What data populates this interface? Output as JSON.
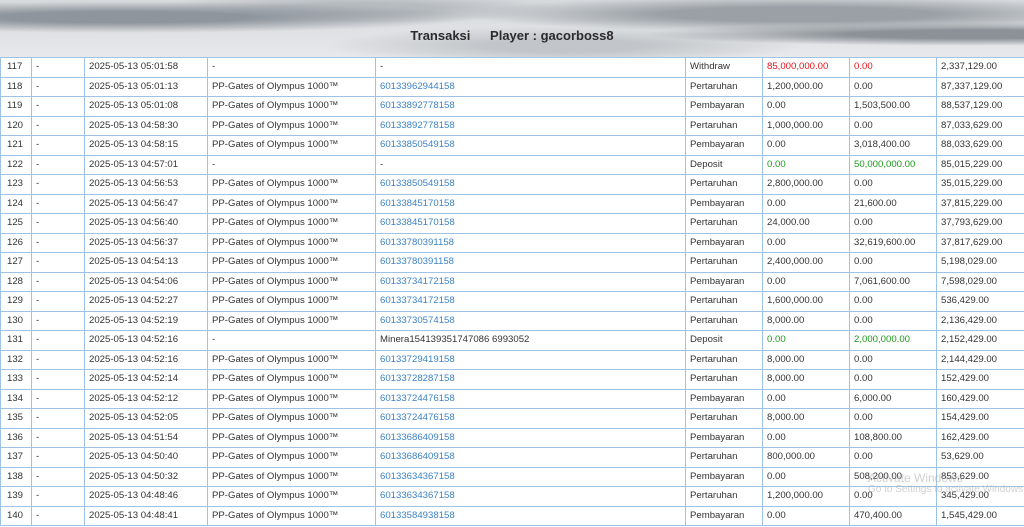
{
  "header": {
    "title": "Transaksi",
    "player": "Player : gacorboss8"
  },
  "rows": [
    {
      "no": "117",
      "col2": "-",
      "date": "2025-05-13 05:01:58",
      "game": "-",
      "ref": "-",
      "type": "Withdraw",
      "debit": "85,000,000.00",
      "credit": "0.00",
      "balance": "2,337,129.00",
      "debit_color": "red",
      "credit_color": "red"
    },
    {
      "no": "118",
      "col2": "-",
      "date": "2025-05-13 05:01:13",
      "game": "PP-Gates of Olympus 1000™",
      "ref": "60133962944158",
      "type": "Pertaruhan",
      "debit": "1,200,000.00",
      "credit": "0.00",
      "balance": "87,337,129.00"
    },
    {
      "no": "119",
      "col2": "-",
      "date": "2025-05-13 05:01:08",
      "game": "PP-Gates of Olympus 1000™",
      "ref": "60133892778158",
      "type": "Pembayaran",
      "debit": "0.00",
      "credit": "1,503,500.00",
      "balance": "88,537,129.00"
    },
    {
      "no": "120",
      "col2": "-",
      "date": "2025-05-13 04:58:30",
      "game": "PP-Gates of Olympus 1000™",
      "ref": "60133892778158",
      "type": "Pertaruhan",
      "debit": "1,000,000.00",
      "credit": "0.00",
      "balance": "87,033,629.00"
    },
    {
      "no": "121",
      "col2": "-",
      "date": "2025-05-13 04:58:15",
      "game": "PP-Gates of Olympus 1000™",
      "ref": "60133850549158",
      "type": "Pembayaran",
      "debit": "0.00",
      "credit": "3,018,400.00",
      "balance": "88,033,629.00"
    },
    {
      "no": "122",
      "col2": "-",
      "date": "2025-05-13 04:57:01",
      "game": "-",
      "ref": "-",
      "type": "Deposit",
      "debit": "0.00",
      "credit": "50,000,000.00",
      "balance": "85,015,229.00",
      "debit_color": "green",
      "credit_color": "green"
    },
    {
      "no": "123",
      "col2": "-",
      "date": "2025-05-13 04:56:53",
      "game": "PP-Gates of Olympus 1000™",
      "ref": "60133850549158",
      "type": "Pertaruhan",
      "debit": "2,800,000.00",
      "credit": "0.00",
      "balance": "35,015,229.00"
    },
    {
      "no": "124",
      "col2": "-",
      "date": "2025-05-13 04:56:47",
      "game": "PP-Gates of Olympus 1000™",
      "ref": "60133845170158",
      "type": "Pembayaran",
      "debit": "0.00",
      "credit": "21,600.00",
      "balance": "37,815,229.00"
    },
    {
      "no": "125",
      "col2": "-",
      "date": "2025-05-13 04:56:40",
      "game": "PP-Gates of Olympus 1000™",
      "ref": "60133845170158",
      "type": "Pertaruhan",
      "debit": "24,000.00",
      "credit": "0.00",
      "balance": "37,793,629.00"
    },
    {
      "no": "126",
      "col2": "-",
      "date": "2025-05-13 04:56:37",
      "game": "PP-Gates of Olympus 1000™",
      "ref": "60133780391158",
      "type": "Pembayaran",
      "debit": "0.00",
      "credit": "32,619,600.00",
      "balance": "37,817,629.00"
    },
    {
      "no": "127",
      "col2": "-",
      "date": "2025-05-13 04:54:13",
      "game": "PP-Gates of Olympus 1000™",
      "ref": "60133780391158",
      "type": "Pertaruhan",
      "debit": "2,400,000.00",
      "credit": "0.00",
      "balance": "5,198,029.00"
    },
    {
      "no": "128",
      "col2": "-",
      "date": "2025-05-13 04:54:06",
      "game": "PP-Gates of Olympus 1000™",
      "ref": "60133734172158",
      "type": "Pembayaran",
      "debit": "0.00",
      "credit": "7,061,600.00",
      "balance": "7,598,029.00"
    },
    {
      "no": "129",
      "col2": "-",
      "date": "2025-05-13 04:52:27",
      "game": "PP-Gates of Olympus 1000™",
      "ref": "60133734172158",
      "type": "Pertaruhan",
      "debit": "1,600,000.00",
      "credit": "0.00",
      "balance": "536,429.00"
    },
    {
      "no": "130",
      "col2": "-",
      "date": "2025-05-13 04:52:19",
      "game": "PP-Gates of Olympus 1000™",
      "ref": "60133730574158",
      "type": "Pertaruhan",
      "debit": "8,000.00",
      "credit": "0.00",
      "balance": "2,136,429.00"
    },
    {
      "no": "131",
      "col2": "-",
      "date": "2025-05-13 04:52:16",
      "game": "-",
      "ref": "Minera154139351747086 6993052",
      "type": "Deposit",
      "debit": "0.00",
      "credit": "2,000,000.00",
      "balance": "2,152,429.00",
      "debit_color": "green",
      "credit_color": "green",
      "ref_plain": true
    },
    {
      "no": "132",
      "col2": "-",
      "date": "2025-05-13 04:52:16",
      "game": "PP-Gates of Olympus 1000™",
      "ref": "60133729419158",
      "type": "Pertaruhan",
      "debit": "8,000.00",
      "credit": "0.00",
      "balance": "2,144,429.00"
    },
    {
      "no": "133",
      "col2": "-",
      "date": "2025-05-13 04:52:14",
      "game": "PP-Gates of Olympus 1000™",
      "ref": "60133728287158",
      "type": "Pertaruhan",
      "debit": "8,000.00",
      "credit": "0.00",
      "balance": "152,429.00"
    },
    {
      "no": "134",
      "col2": "-",
      "date": "2025-05-13 04:52:12",
      "game": "PP-Gates of Olympus 1000™",
      "ref": "60133724476158",
      "type": "Pembayaran",
      "debit": "0.00",
      "credit": "6,000.00",
      "balance": "160,429.00"
    },
    {
      "no": "135",
      "col2": "-",
      "date": "2025-05-13 04:52:05",
      "game": "PP-Gates of Olympus 1000™",
      "ref": "60133724476158",
      "type": "Pertaruhan",
      "debit": "8,000.00",
      "credit": "0.00",
      "balance": "154,429.00"
    },
    {
      "no": "136",
      "col2": "-",
      "date": "2025-05-13 04:51:54",
      "game": "PP-Gates of Olympus 1000™",
      "ref": "60133686409158",
      "type": "Pembayaran",
      "debit": "0.00",
      "credit": "108,800.00",
      "balance": "162,429.00"
    },
    {
      "no": "137",
      "col2": "-",
      "date": "2025-05-13 04:50:40",
      "game": "PP-Gates of Olympus 1000™",
      "ref": "60133686409158",
      "type": "Pertaruhan",
      "debit": "800,000.00",
      "credit": "0.00",
      "balance": "53,629.00"
    },
    {
      "no": "138",
      "col2": "-",
      "date": "2025-05-13 04:50:32",
      "game": "PP-Gates of Olympus 1000™",
      "ref": "60133634367158",
      "type": "Pembayaran",
      "debit": "0.00",
      "credit": "508,200.00",
      "balance": "853,629.00"
    },
    {
      "no": "139",
      "col2": "-",
      "date": "2025-05-13 04:48:46",
      "game": "PP-Gates of Olympus 1000™",
      "ref": "60133634367158",
      "type": "Pertaruhan",
      "debit": "1,200,000.00",
      "credit": "0.00",
      "balance": "345,429.00"
    },
    {
      "no": "140",
      "col2": "-",
      "date": "2025-05-13 04:48:41",
      "game": "PP-Gates of Olympus 1000™",
      "ref": "60133584938158",
      "type": "Pembayaran",
      "debit": "0.00",
      "credit": "470,400.00",
      "balance": "1,545,429.00"
    }
  ],
  "watermark": {
    "line1": "Activate Windows",
    "line2": "Go to Settings to activate Windows."
  },
  "colors": {
    "link": "#3d83c6",
    "red": "#e5141b",
    "green": "#1b9a1b",
    "border": "#9ec3e4"
  }
}
